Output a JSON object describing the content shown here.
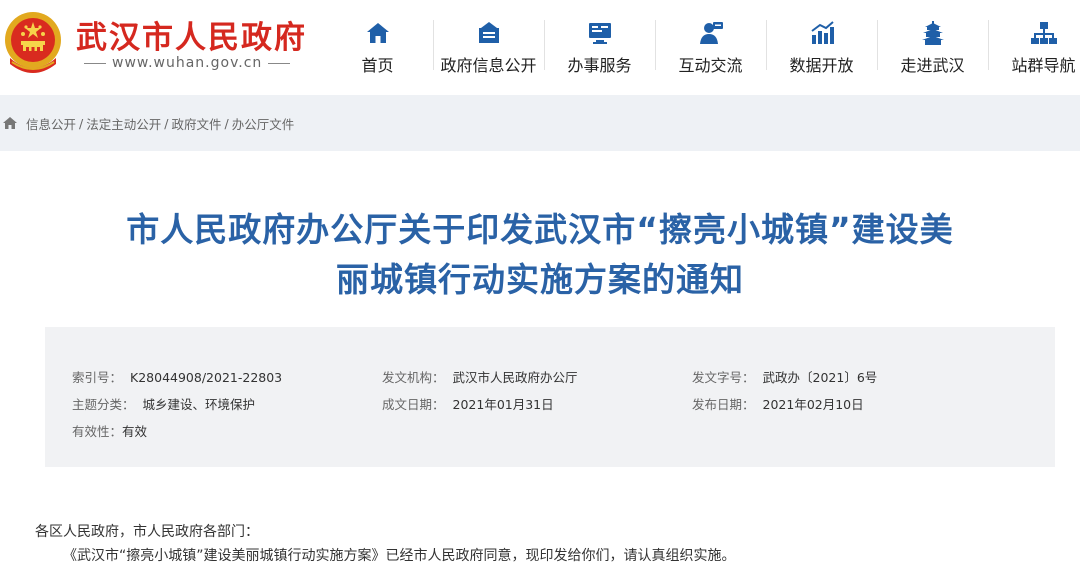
{
  "site": {
    "title": "武汉市人民政府",
    "url": "www.wuhan.gov.cn"
  },
  "nav": [
    {
      "label": "首页",
      "icon": "home-icon"
    },
    {
      "label": "政府信息公开",
      "icon": "info-open-icon"
    },
    {
      "label": "办事服务",
      "icon": "service-monitor-icon"
    },
    {
      "label": "互动交流",
      "icon": "interaction-user-icon"
    },
    {
      "label": "数据开放",
      "icon": "bar-chart-icon"
    },
    {
      "label": "走进武汉",
      "icon": "pagoda-icon"
    },
    {
      "label": "站群导航",
      "icon": "sitemap-icon"
    }
  ],
  "breadcrumb": [
    "信息公开",
    "法定主动公开",
    "政府文件",
    "办公厅文件"
  ],
  "document": {
    "title_line1": "市人民政府办公厅关于印发武汉市“擦亮小城镇”建设美",
    "title_line2": "丽城镇行动实施方案的通知"
  },
  "meta": {
    "index_label": "索引号：",
    "index_value": "K28044908/2021-22803",
    "agency_label": "发文机构：",
    "agency_value": "武汉市人民政府办公厅",
    "doc_no_label": "发文字号：",
    "doc_no_value": "武政办〔2021〕6号",
    "topic_label": "主题分类：",
    "topic_value": "城乡建设、环境保护",
    "written_label": "成文日期：",
    "written_value": "2021年01月31日",
    "published_label": "发布日期：",
    "published_value": "2021年02月10日",
    "validity_label": "有效性：",
    "validity_value": "有效"
  },
  "body": {
    "salutation": "各区人民政府，市人民政府各部门：",
    "paragraph1": "《武汉市“擦亮小城镇”建设美丽城镇行动实施方案》已经市人民政府同意，现印发给你们，请认真组织实施。"
  },
  "colors": {
    "brand_red": "#d5281f",
    "title_blue": "#2a62a6",
    "nav_icon": "#1f5fa8",
    "breadcrumb_bg": "#eef1f5",
    "meta_bg": "#f1f2f4"
  }
}
